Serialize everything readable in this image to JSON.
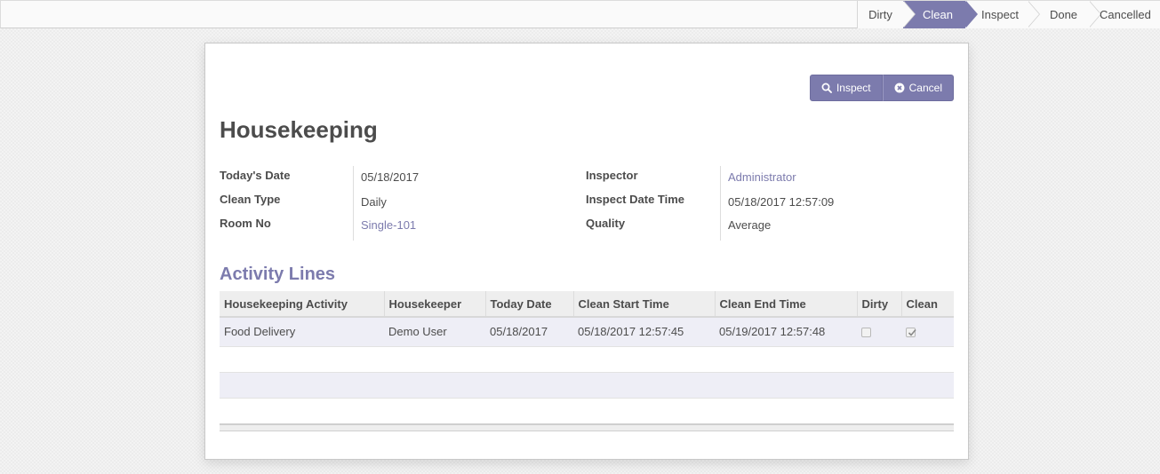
{
  "statusbar": {
    "steps": [
      {
        "label": "Dirty",
        "active": false
      },
      {
        "label": "Clean",
        "active": true
      },
      {
        "label": "Inspect",
        "active": false
      },
      {
        "label": "Done",
        "active": false
      },
      {
        "label": "Cancelled",
        "active": false
      }
    ]
  },
  "buttons": {
    "inspect_label": "Inspect",
    "cancel_label": "Cancel"
  },
  "form": {
    "title": "Housekeeping",
    "left": [
      {
        "label": "Today's Date",
        "value": "05/18/2017"
      },
      {
        "label": "Clean Type",
        "value": "Daily"
      },
      {
        "label": "Room No",
        "value": "Single-101"
      }
    ],
    "right": [
      {
        "label": "Inspector",
        "value": "Administrator"
      },
      {
        "label": "Inspect Date Time",
        "value": "05/18/2017 12:57:09"
      },
      {
        "label": "Quality",
        "value": "Average"
      }
    ]
  },
  "activity": {
    "section_title": "Activity Lines",
    "columns": [
      "Housekeeping Activity",
      "Housekeeper",
      "Today Date",
      "Clean Start Time",
      "Clean End Time",
      "Dirty",
      "Clean"
    ],
    "rows": [
      {
        "activity": "Food Delivery",
        "housekeeper": "Demo User",
        "today_date": "05/18/2017",
        "start_time": "05/18/2017 12:57:45",
        "end_time": "05/19/2017 12:57:48",
        "dirty": false,
        "clean": true
      }
    ]
  },
  "colors": {
    "accent": "#7c7bad",
    "text": "#4c4c4c",
    "row_highlight": "#eeeef6"
  },
  "icons": {
    "inspect": "search-icon",
    "cancel": "times-circle-icon",
    "check": "check-icon"
  }
}
